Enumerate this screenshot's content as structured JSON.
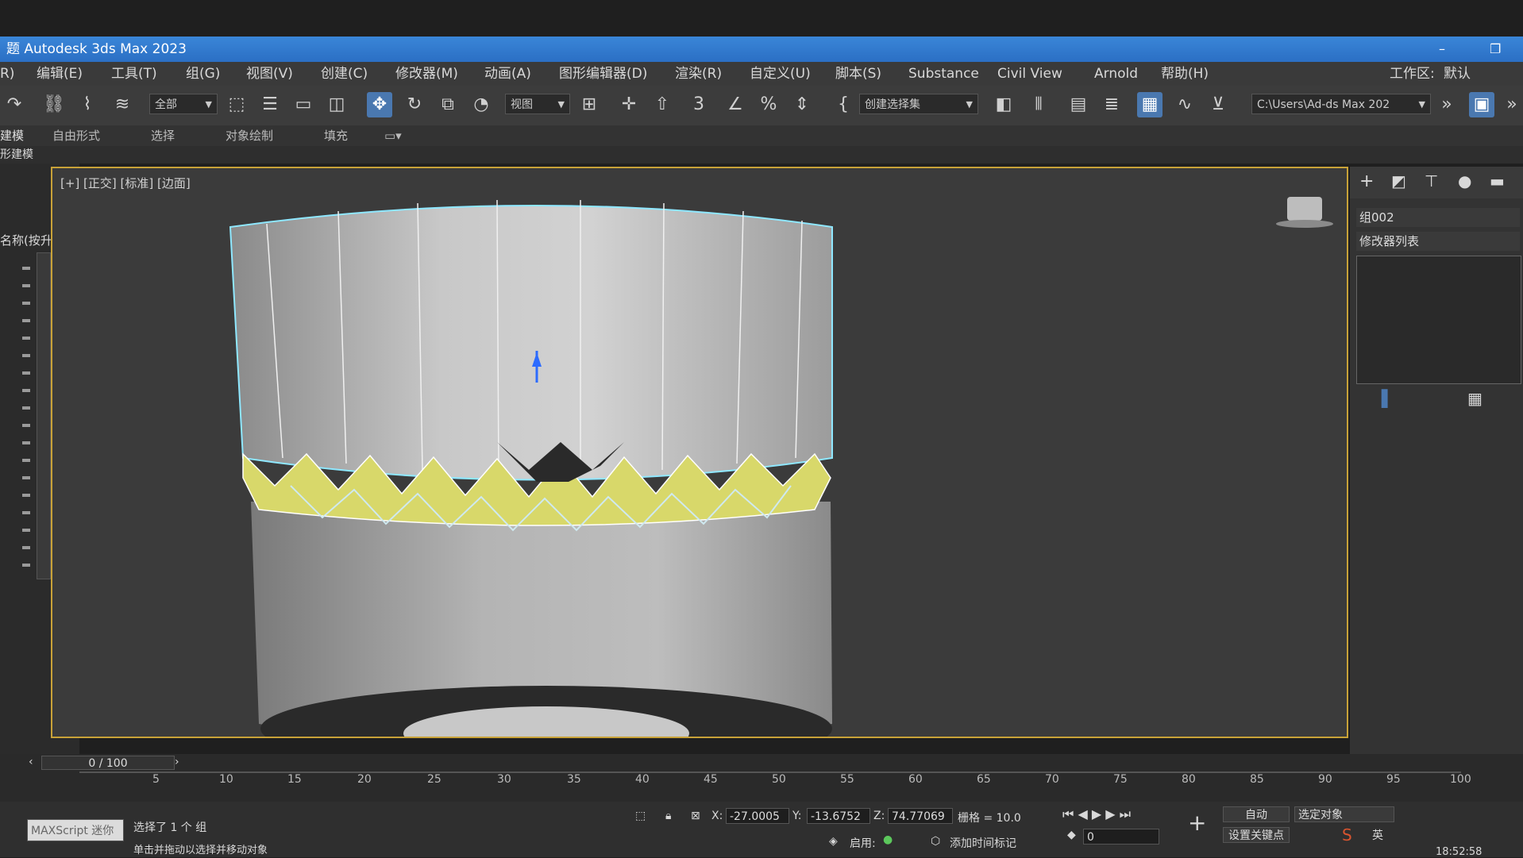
{
  "window": {
    "title": "Autodesk 3ds Max 2023",
    "icon_char": "题",
    "minimize": "–",
    "restore": "❐"
  },
  "menu": [
    "R)",
    "编辑(E)",
    "工具(T)",
    "组(G)",
    "视图(V)",
    "创建(C)",
    "修改器(M)",
    "动画(A)",
    "图形编辑器(D)",
    "渲染(R)",
    "自定义(U)",
    "脚本(S)",
    "Substance",
    "Civil View",
    "Arnold",
    "帮助(H)"
  ],
  "workspace": {
    "label": "工作区:",
    "value": "默认"
  },
  "toolbar": {
    "selection_filter": "全部",
    "ref_coord": "视图",
    "named_selection": "创建选择集",
    "path": "C:\\Users\\Ad‐ds Max 202",
    "snap_count": "3"
  },
  "ribbon": {
    "tabs": [
      "建模",
      "自由形式",
      "选择",
      "对象绘制",
      "填充"
    ],
    "sub": "形建模"
  },
  "scene_explorer": {
    "header": "名称(按升)"
  },
  "viewport": {
    "label": "[+] [正交] [标准] [边面]",
    "object_name": "组002",
    "modifier_list": "修改器列表"
  },
  "timeline": {
    "frame_display": "0 / 100",
    "ticks": [
      "5",
      "10",
      "15",
      "20",
      "25",
      "30",
      "35",
      "40",
      "45",
      "50",
      "55",
      "60",
      "65",
      "70",
      "75",
      "80",
      "85",
      "90",
      "95",
      "100"
    ]
  },
  "status": {
    "maxscript": "MAXScript 迷你",
    "selection_info": "选择了 1 个 组",
    "prompt": "单击并拖动以选择并移动对象",
    "x_label": "X:",
    "x_value": "-27.0005",
    "y_label": "Y:",
    "y_value": "-13.6752",
    "z_label": "Z:",
    "z_value": "74.77069",
    "grid": "栅格 = 10.0",
    "enable_label": "启用:",
    "time_tag": "添加时间标记",
    "auto_key": "自动",
    "selected_object": "选定对象",
    "set_key": "设置关键点",
    "frame_value": "0",
    "ime": "英",
    "clock": "18:52:58"
  }
}
